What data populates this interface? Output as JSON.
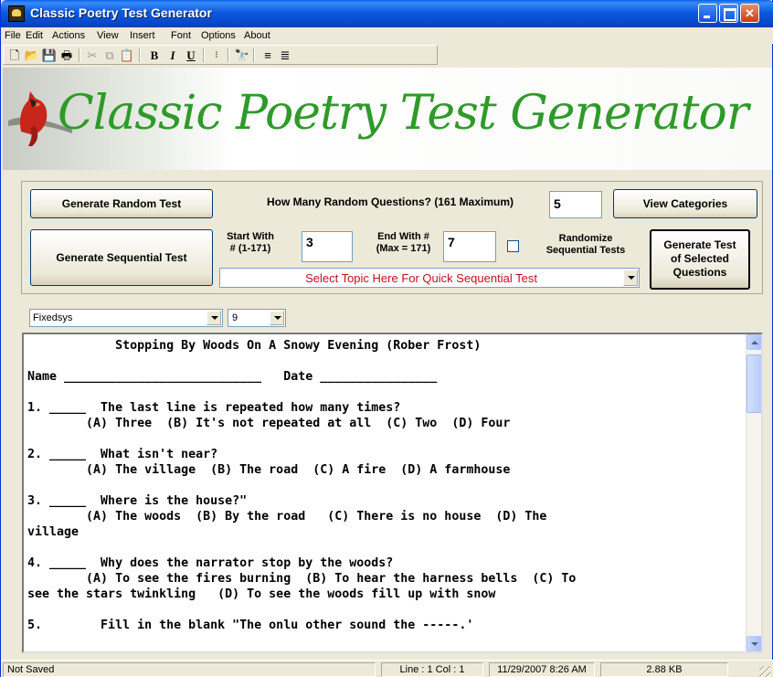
{
  "window": {
    "title": "Classic Poetry Test Generator"
  },
  "menu": [
    "File",
    "Edit",
    "Actions",
    "View",
    "Insert",
    "Font",
    "Options",
    "About"
  ],
  "toolbar": {
    "icons": [
      "new-file-icon",
      "open-folder-icon",
      "save-icon",
      "print-icon",
      "cut-icon",
      "copy-icon",
      "paste-icon",
      "bold-icon",
      "italic-icon",
      "underline-icon",
      "bullets-icon",
      "find-icon",
      "align-left-icon",
      "align-center-icon"
    ],
    "bold": "B",
    "italic": "I",
    "underline": "U"
  },
  "banner": {
    "title": "Classic Poetry Test Generator"
  },
  "controls": {
    "generate_random": "Generate Random Test",
    "random_label": "How Many Random Questions? (161 Maximum)",
    "random_count": "5",
    "view_categories": "View Categories",
    "generate_sequential": "Generate Sequential Test",
    "start_label_1": "Start With",
    "start_label_2": "# (1-171)",
    "start_value": "3",
    "end_label_1": "End With #",
    "end_label_2": "(Max = 171)",
    "end_value": "7",
    "randomize_label_1": "Randomize",
    "randomize_label_2": "Sequential Tests",
    "randomize_checked": false,
    "topic_placeholder": "Select Topic Here For Quick Sequential Test",
    "generate_selected_1": "Generate Test",
    "generate_selected_2": "of Selected",
    "generate_selected_3": "Questions"
  },
  "font": {
    "family": "Fixedsys",
    "size": "9"
  },
  "document": {
    "lines": [
      "            Stopping By Woods On A Snowy Evening (Rober Frost)",
      "",
      "Name ___________________________   Date ________________",
      "",
      "1. _____  The last line is repeated how many times?",
      "        (A) Three  (B) It's not repeated at all  (C) Two  (D) Four",
      "",
      "2. _____  What isn't near?",
      "        (A) The village  (B) The road  (C) A fire  (D) A farmhouse",
      "",
      "3. _____  Where is the house?\"",
      "        (A) The woods  (B) By the road   (C) There is no house  (D) The",
      "village",
      "",
      "4. _____  Why does the narrator stop by the woods?",
      "        (A) To see the fires burning  (B) To hear the harness bells  (C) To",
      "see the stars twinkling   (D) To see the woods fill up with snow",
      "",
      "5.        Fill in the blank \"The onlu other sound the -----.'"
    ]
  },
  "status": {
    "saved": "Not Saved",
    "position": "Line : 1   Col : 1",
    "datetime": "11/29/2007  8:26 AM",
    "size": "2.88 KB"
  }
}
